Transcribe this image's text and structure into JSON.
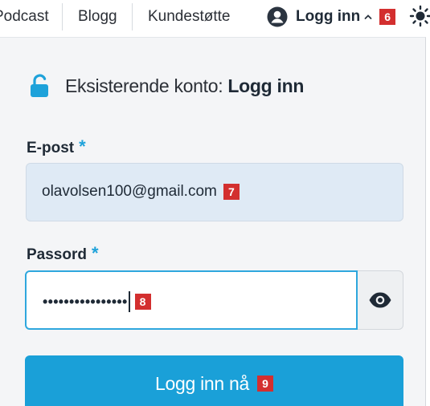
{
  "nav": {
    "items": [
      "Podcast",
      "Blogg",
      "Kundestøtte"
    ],
    "login_label": "Logg inn",
    "login_marker": "6"
  },
  "login": {
    "heading_prefix": "Eksisterende konto: ",
    "heading_strong": "Logg inn",
    "email_label": "E-post",
    "email_value": "olavolsen100@gmail.com",
    "email_marker": "7",
    "password_label": "Passord",
    "password_masked": "••••••••••••••••",
    "password_marker": "8",
    "required_mark": "*",
    "submit_label": "Logg inn nå",
    "submit_marker": "9"
  },
  "icons": {
    "account": "user-circle-icon",
    "chevron": "chevron-up-icon",
    "theme": "sun-icon",
    "lock": "unlock-icon",
    "show_password": "eye-icon"
  },
  "colors": {
    "accent": "#1aa0d8",
    "marker": "#d32f2f",
    "email_bg": "#dfeaf5"
  }
}
